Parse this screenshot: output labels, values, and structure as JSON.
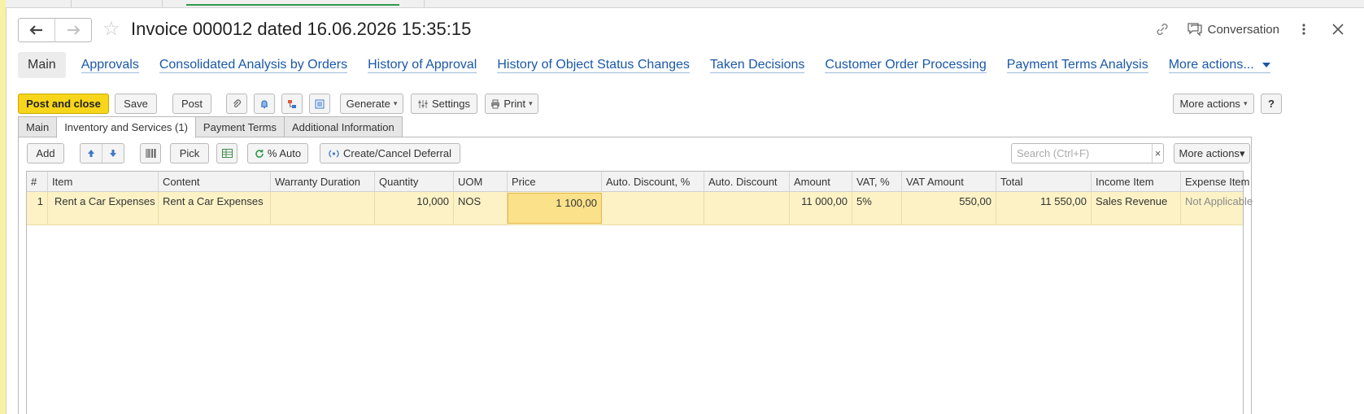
{
  "window": {
    "title": "Invoice 000012 dated 16.06.2026 15:35:15",
    "conversation_label": "Conversation"
  },
  "link_tabs": [
    {
      "label": "Main"
    },
    {
      "label": "Approvals"
    },
    {
      "label": "Consolidated Analysis by Orders"
    },
    {
      "label": "History of Approval"
    },
    {
      "label": "History of Object Status Changes"
    },
    {
      "label": "Taken Decisions"
    },
    {
      "label": "Customer Order Processing"
    },
    {
      "label": "Payment Terms Analysis"
    },
    {
      "label": "More actions..."
    }
  ],
  "toolbar": {
    "post_and_close": "Post and close",
    "save": "Save",
    "post": "Post",
    "generate": "Generate",
    "settings": "Settings",
    "print": "Print",
    "more_actions": "More actions",
    "help": "?"
  },
  "form_tabs": [
    {
      "label": "Main"
    },
    {
      "label": "Inventory and Services (1)"
    },
    {
      "label": "Payment Terms"
    },
    {
      "label": "Additional Information"
    }
  ],
  "table_toolbar": {
    "add": "Add",
    "pick": "Pick",
    "auto_percent": "% Auto",
    "deferral": "Create/Cancel Deferral",
    "search_placeholder": "Search (Ctrl+F)",
    "clear": "×",
    "more_actions": "More actions"
  },
  "table": {
    "columns": [
      "#",
      "Item",
      "Content",
      "Warranty Duration",
      "Quantity",
      "UOM",
      "Price",
      "Auto. Discount, %",
      "Auto. Discount",
      "Amount",
      "VAT, %",
      "VAT Amount",
      "Total",
      "Income Item",
      "Expense Item"
    ],
    "rows": [
      [
        "1",
        "Rent a Car Expenses",
        "Rent a Car Expenses",
        "",
        "10,000",
        "NOS",
        "1 100,00",
        "",
        "",
        "11 000,00",
        "5%",
        "550,00",
        "11 550,00",
        "Sales Revenue",
        "Not Applicable"
      ]
    ]
  },
  "colors": {
    "primary_button": "#f7d51a",
    "link": "#1a58a8",
    "row_highlight": "#fcf2c5",
    "cell_selected": "#fbe18a"
  }
}
